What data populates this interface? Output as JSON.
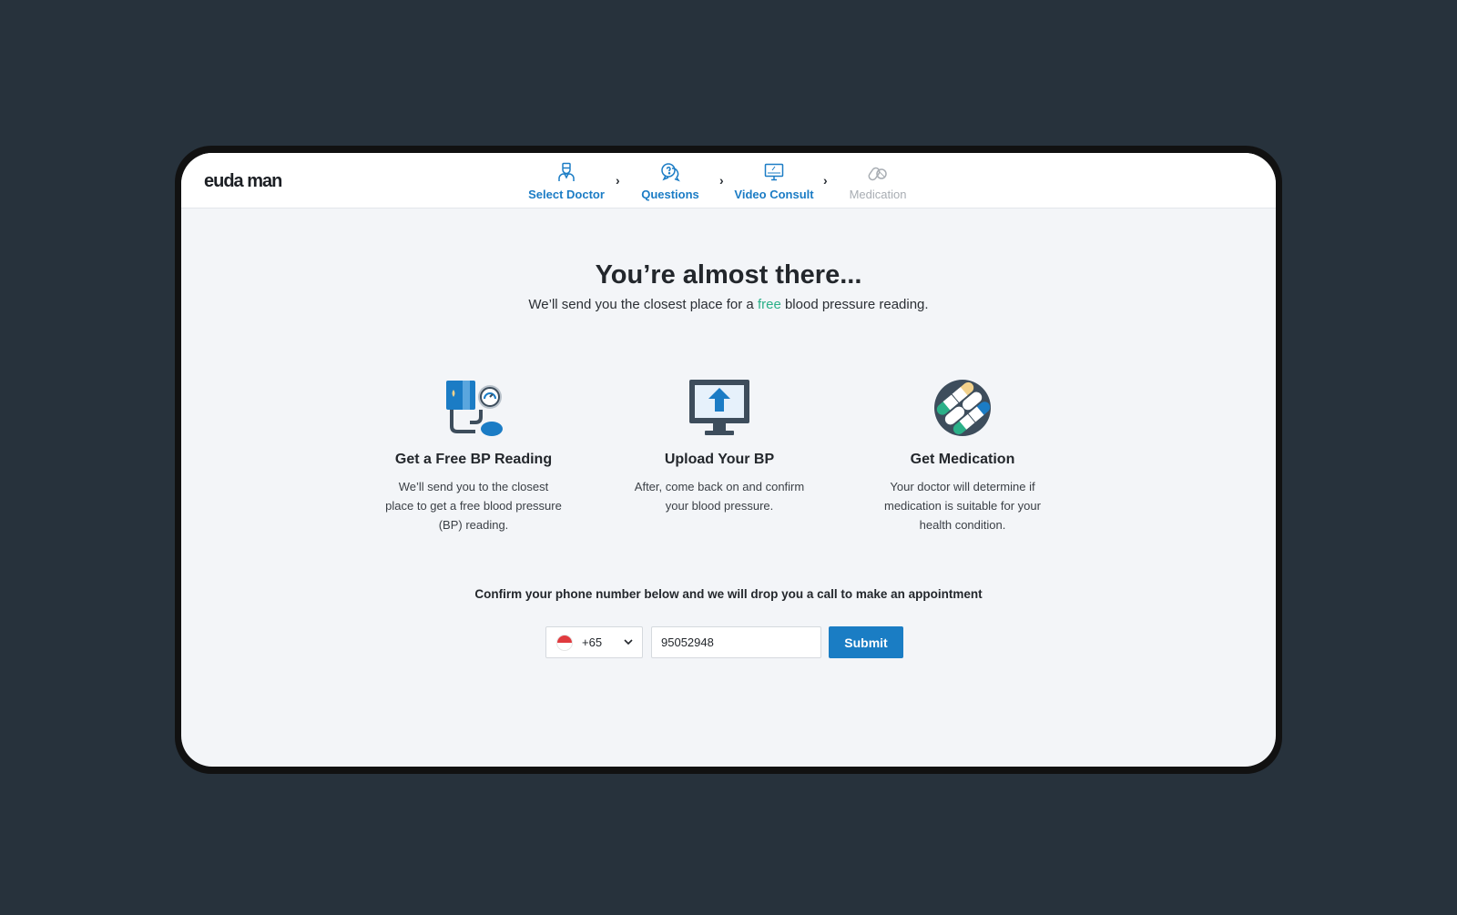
{
  "app": {
    "logo": "euda man"
  },
  "steps": [
    {
      "label": "Select Doctor",
      "icon": "doctor-icon",
      "state": "active"
    },
    {
      "label": "Questions",
      "icon": "chat-question-icon",
      "state": "active"
    },
    {
      "label": "Video Consult",
      "icon": "monitor-icon",
      "state": "active"
    },
    {
      "label": "Medication",
      "icon": "pills-icon",
      "state": "inactive"
    }
  ],
  "hero": {
    "title": "You’re almost there...",
    "subtitle_before": "We’ll send you the closest place for a ",
    "subtitle_highlight": "free",
    "subtitle_after": " blood pressure reading."
  },
  "cards": [
    {
      "icon": "blood-pressure-monitor-icon",
      "title": "Get a Free BP Reading",
      "text": "We’ll send you to the closest place to get a free blood pressure (BP) reading."
    },
    {
      "icon": "upload-monitor-icon",
      "title": "Upload Your BP",
      "text": "After, come back on and confirm your blood pressure."
    },
    {
      "icon": "medication-pills-icon",
      "title": "Get Medication",
      "text": "Your doctor will determine if medication is suitable for your health condition."
    }
  ],
  "form": {
    "prompt": "Confirm your phone number below and we will drop you a call to make an appointment",
    "country_code": "+65",
    "country_flag": "singapore-flag-icon",
    "phone_value": "95052948",
    "submit_label": "Submit"
  },
  "colors": {
    "background": "#27323c",
    "accent": "#1a7dc4",
    "highlight": "#2bb088",
    "inactive": "#a8adb3"
  }
}
